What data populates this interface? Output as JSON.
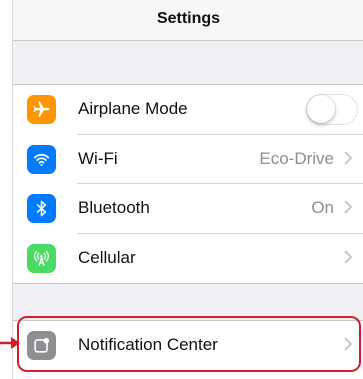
{
  "navbar": {
    "title": "Settings"
  },
  "settings": {
    "airplane": {
      "label": "Airplane Mode",
      "enabled": false,
      "icon": "airplane-icon",
      "color": "#ff9500"
    },
    "wifi": {
      "label": "Wi-Fi",
      "value": "Eco-Drive",
      "icon": "wifi-icon",
      "color": "#007aff"
    },
    "bluetooth": {
      "label": "Bluetooth",
      "value": "On",
      "icon": "bluetooth-icon",
      "color": "#007aff"
    },
    "cellular": {
      "label": "Cellular",
      "icon": "cellular-antenna-icon",
      "color": "#4cd964"
    },
    "notification_center": {
      "label": "Notification Center",
      "icon": "notification-center-icon",
      "color": "#8e8e93"
    }
  },
  "annotation": {
    "highlight_color": "#d21f2b"
  }
}
